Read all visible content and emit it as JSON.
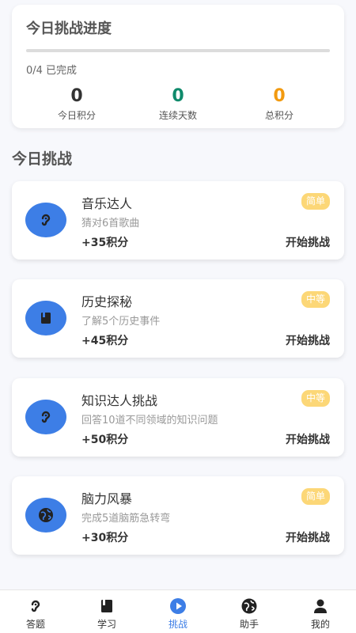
{
  "progress": {
    "title": "今日挑战进度",
    "completed_text": "0/4 已完成",
    "fraction": 0,
    "stats": [
      {
        "value": "0",
        "label": "今日积分"
      },
      {
        "value": "0",
        "label": "连续天数"
      },
      {
        "value": "0",
        "label": "总积分"
      }
    ]
  },
  "section_title": "今日挑战",
  "challenges": [
    {
      "title": "音乐达人",
      "desc": "猜对6首歌曲",
      "points": "+35积分",
      "action": "开始挑战",
      "badge": "简单",
      "icon": "ear-icon"
    },
    {
      "title": "历史探秘",
      "desc": "了解5个历史事件",
      "points": "+45积分",
      "action": "开始挑战",
      "badge": "中等",
      "icon": "book-icon"
    },
    {
      "title": "知识达人挑战",
      "desc": "回答10道不同领域的知识问题",
      "points": "+50积分",
      "action": "开始挑战",
      "badge": "中等",
      "icon": "ear-icon"
    },
    {
      "title": "脑力风暴",
      "desc": "完成5道脑筋急转弯",
      "points": "+30积分",
      "action": "开始挑战",
      "badge": "简单",
      "icon": "globe-icon"
    }
  ],
  "tabs": [
    {
      "label": "答题",
      "icon": "ear-icon",
      "active": false
    },
    {
      "label": "学习",
      "icon": "book-icon",
      "active": false
    },
    {
      "label": "挑战",
      "icon": "play-icon",
      "active": true
    },
    {
      "label": "助手",
      "icon": "globe-icon",
      "active": false
    },
    {
      "label": "我的",
      "icon": "person-icon",
      "active": false
    }
  ],
  "colors": {
    "accent": "#3d7ee6",
    "badge": "#fcd777",
    "green": "#0f8a6b",
    "orange": "#f29a10"
  }
}
